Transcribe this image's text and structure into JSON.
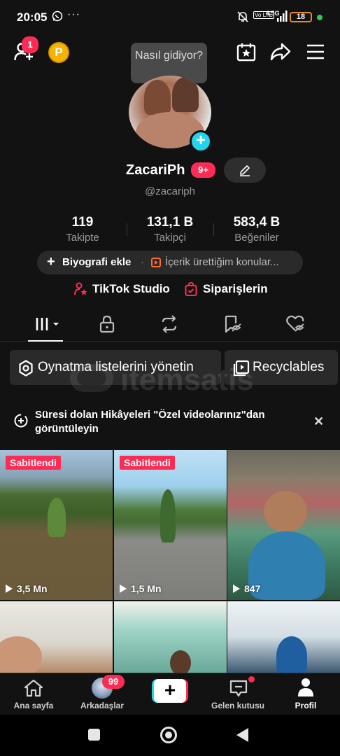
{
  "status_bar": {
    "time": "20:05",
    "notification_dots": "···",
    "volte": "Vo LTE",
    "network": "4.5G",
    "battery": "18"
  },
  "header": {
    "add_friend_badge": "1",
    "coin_label": "P",
    "tooltip": "Nasıl gidiyor?"
  },
  "profile": {
    "display_name": "ZacariPh",
    "name_badge": "9+",
    "username": "@zacariph",
    "stats": [
      {
        "value": "119",
        "label": "Takipte"
      },
      {
        "value": "131,1 B",
        "label": "Takipçi"
      },
      {
        "value": "583,4 B",
        "label": "Beğeniler"
      }
    ],
    "bio_add_label": "Biyografi ekle",
    "bio_separator": "·",
    "content_topics": "İçerik ürettiğim konular...",
    "tiktok_studio": "TikTok Studio",
    "orders": "Siparişlerin"
  },
  "actions": {
    "manage_playlists": "Oynatma listelerini yönetin",
    "recyclables": "Recyclables"
  },
  "watermark": "itemsatis",
  "story_notice": {
    "text": "Süresi dolan Hikâyeleri \"Özel videolarınız\"dan görüntüleyin",
    "close": "✕"
  },
  "videos": [
    {
      "pinned": "Sabitlendi",
      "views": "3,5 Mn"
    },
    {
      "pinned": "Sabitlendi",
      "views": "1,5 Mn"
    },
    {
      "pinned": "",
      "views": "847"
    }
  ],
  "bottom_nav": {
    "home": "Ana sayfa",
    "friends": "Arkadaşlar",
    "friends_badge": "99",
    "create": "+",
    "inbox": "Gelen kutusu",
    "profile": "Profil"
  },
  "colors": {
    "accent_red": "#fe2c55",
    "accent_cyan": "#20d5ec",
    "background": "#121212"
  }
}
